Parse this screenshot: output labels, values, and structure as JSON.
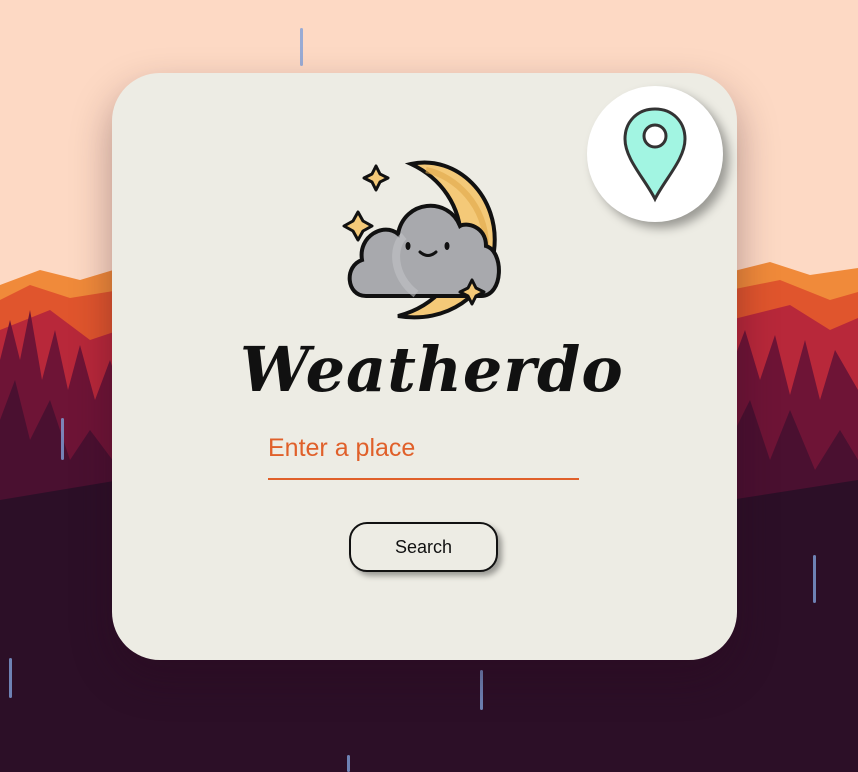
{
  "app": {
    "title": "Weatherdo"
  },
  "icons": {
    "location": "location-pin-icon",
    "logo": "cloud-moon-icon"
  },
  "search": {
    "placeholder": "Enter a place",
    "value": "",
    "button_label": "Search"
  },
  "colors": {
    "accent": "#e0602a",
    "card": "#edece4",
    "pin": "#a2f5e2",
    "moon": "#f4c978",
    "cloud": "#a8a9ad",
    "sky": "#fdd9c4",
    "forest_dark": "#2c0f27"
  }
}
